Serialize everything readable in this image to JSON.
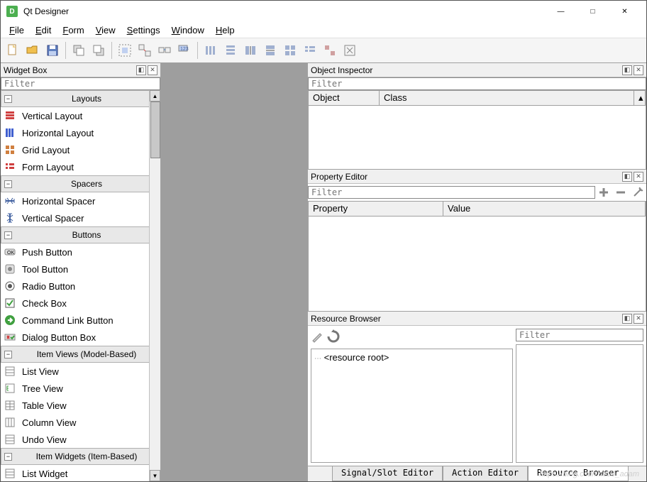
{
  "app": {
    "title": "Qt Designer",
    "iconLetter": "D"
  },
  "menu": [
    "File",
    "Edit",
    "Form",
    "View",
    "Settings",
    "Window",
    "Help"
  ],
  "widgetBox": {
    "title": "Widget Box",
    "filterPlaceholder": "Filter",
    "categories": [
      {
        "name": "Layouts",
        "items": [
          {
            "label": "Vertical Layout",
            "icon": "vlayout"
          },
          {
            "label": "Horizontal Layout",
            "icon": "hlayout"
          },
          {
            "label": "Grid Layout",
            "icon": "grid"
          },
          {
            "label": "Form Layout",
            "icon": "form"
          }
        ]
      },
      {
        "name": "Spacers",
        "items": [
          {
            "label": "Horizontal Spacer",
            "icon": "hspacer"
          },
          {
            "label": "Vertical Spacer",
            "icon": "vspacer"
          }
        ]
      },
      {
        "name": "Buttons",
        "items": [
          {
            "label": "Push Button",
            "icon": "pushbtn"
          },
          {
            "label": "Tool Button",
            "icon": "toolbtn"
          },
          {
            "label": "Radio Button",
            "icon": "radio"
          },
          {
            "label": "Check Box",
            "icon": "checkbox"
          },
          {
            "label": "Command Link Button",
            "icon": "cmdlink"
          },
          {
            "label": "Dialog Button Box",
            "icon": "dlgbox"
          }
        ]
      },
      {
        "name": "Item Views (Model-Based)",
        "items": [
          {
            "label": "List View",
            "icon": "listview"
          },
          {
            "label": "Tree View",
            "icon": "treeview"
          },
          {
            "label": "Table View",
            "icon": "tableview"
          },
          {
            "label": "Column View",
            "icon": "colview"
          },
          {
            "label": "Undo View",
            "icon": "undoview"
          }
        ]
      },
      {
        "name": "Item Widgets (Item-Based)",
        "items": [
          {
            "label": "List Widget",
            "icon": "listview"
          }
        ]
      }
    ]
  },
  "objectInspector": {
    "title": "Object Inspector",
    "filterPlaceholder": "Filter",
    "columns": [
      "Object",
      "Class"
    ]
  },
  "propertyEditor": {
    "title": "Property Editor",
    "filterPlaceholder": "Filter",
    "columns": [
      "Property",
      "Value"
    ]
  },
  "resourceBrowser": {
    "title": "Resource Browser",
    "filterPlaceholder": "Filter",
    "rootLabel": "<resource root>"
  },
  "bottomTabs": [
    "Signal/Slot Editor",
    "Action Editor",
    "Resource Browser"
  ],
  "watermark": "https://blog.csdn.net/J_adam"
}
